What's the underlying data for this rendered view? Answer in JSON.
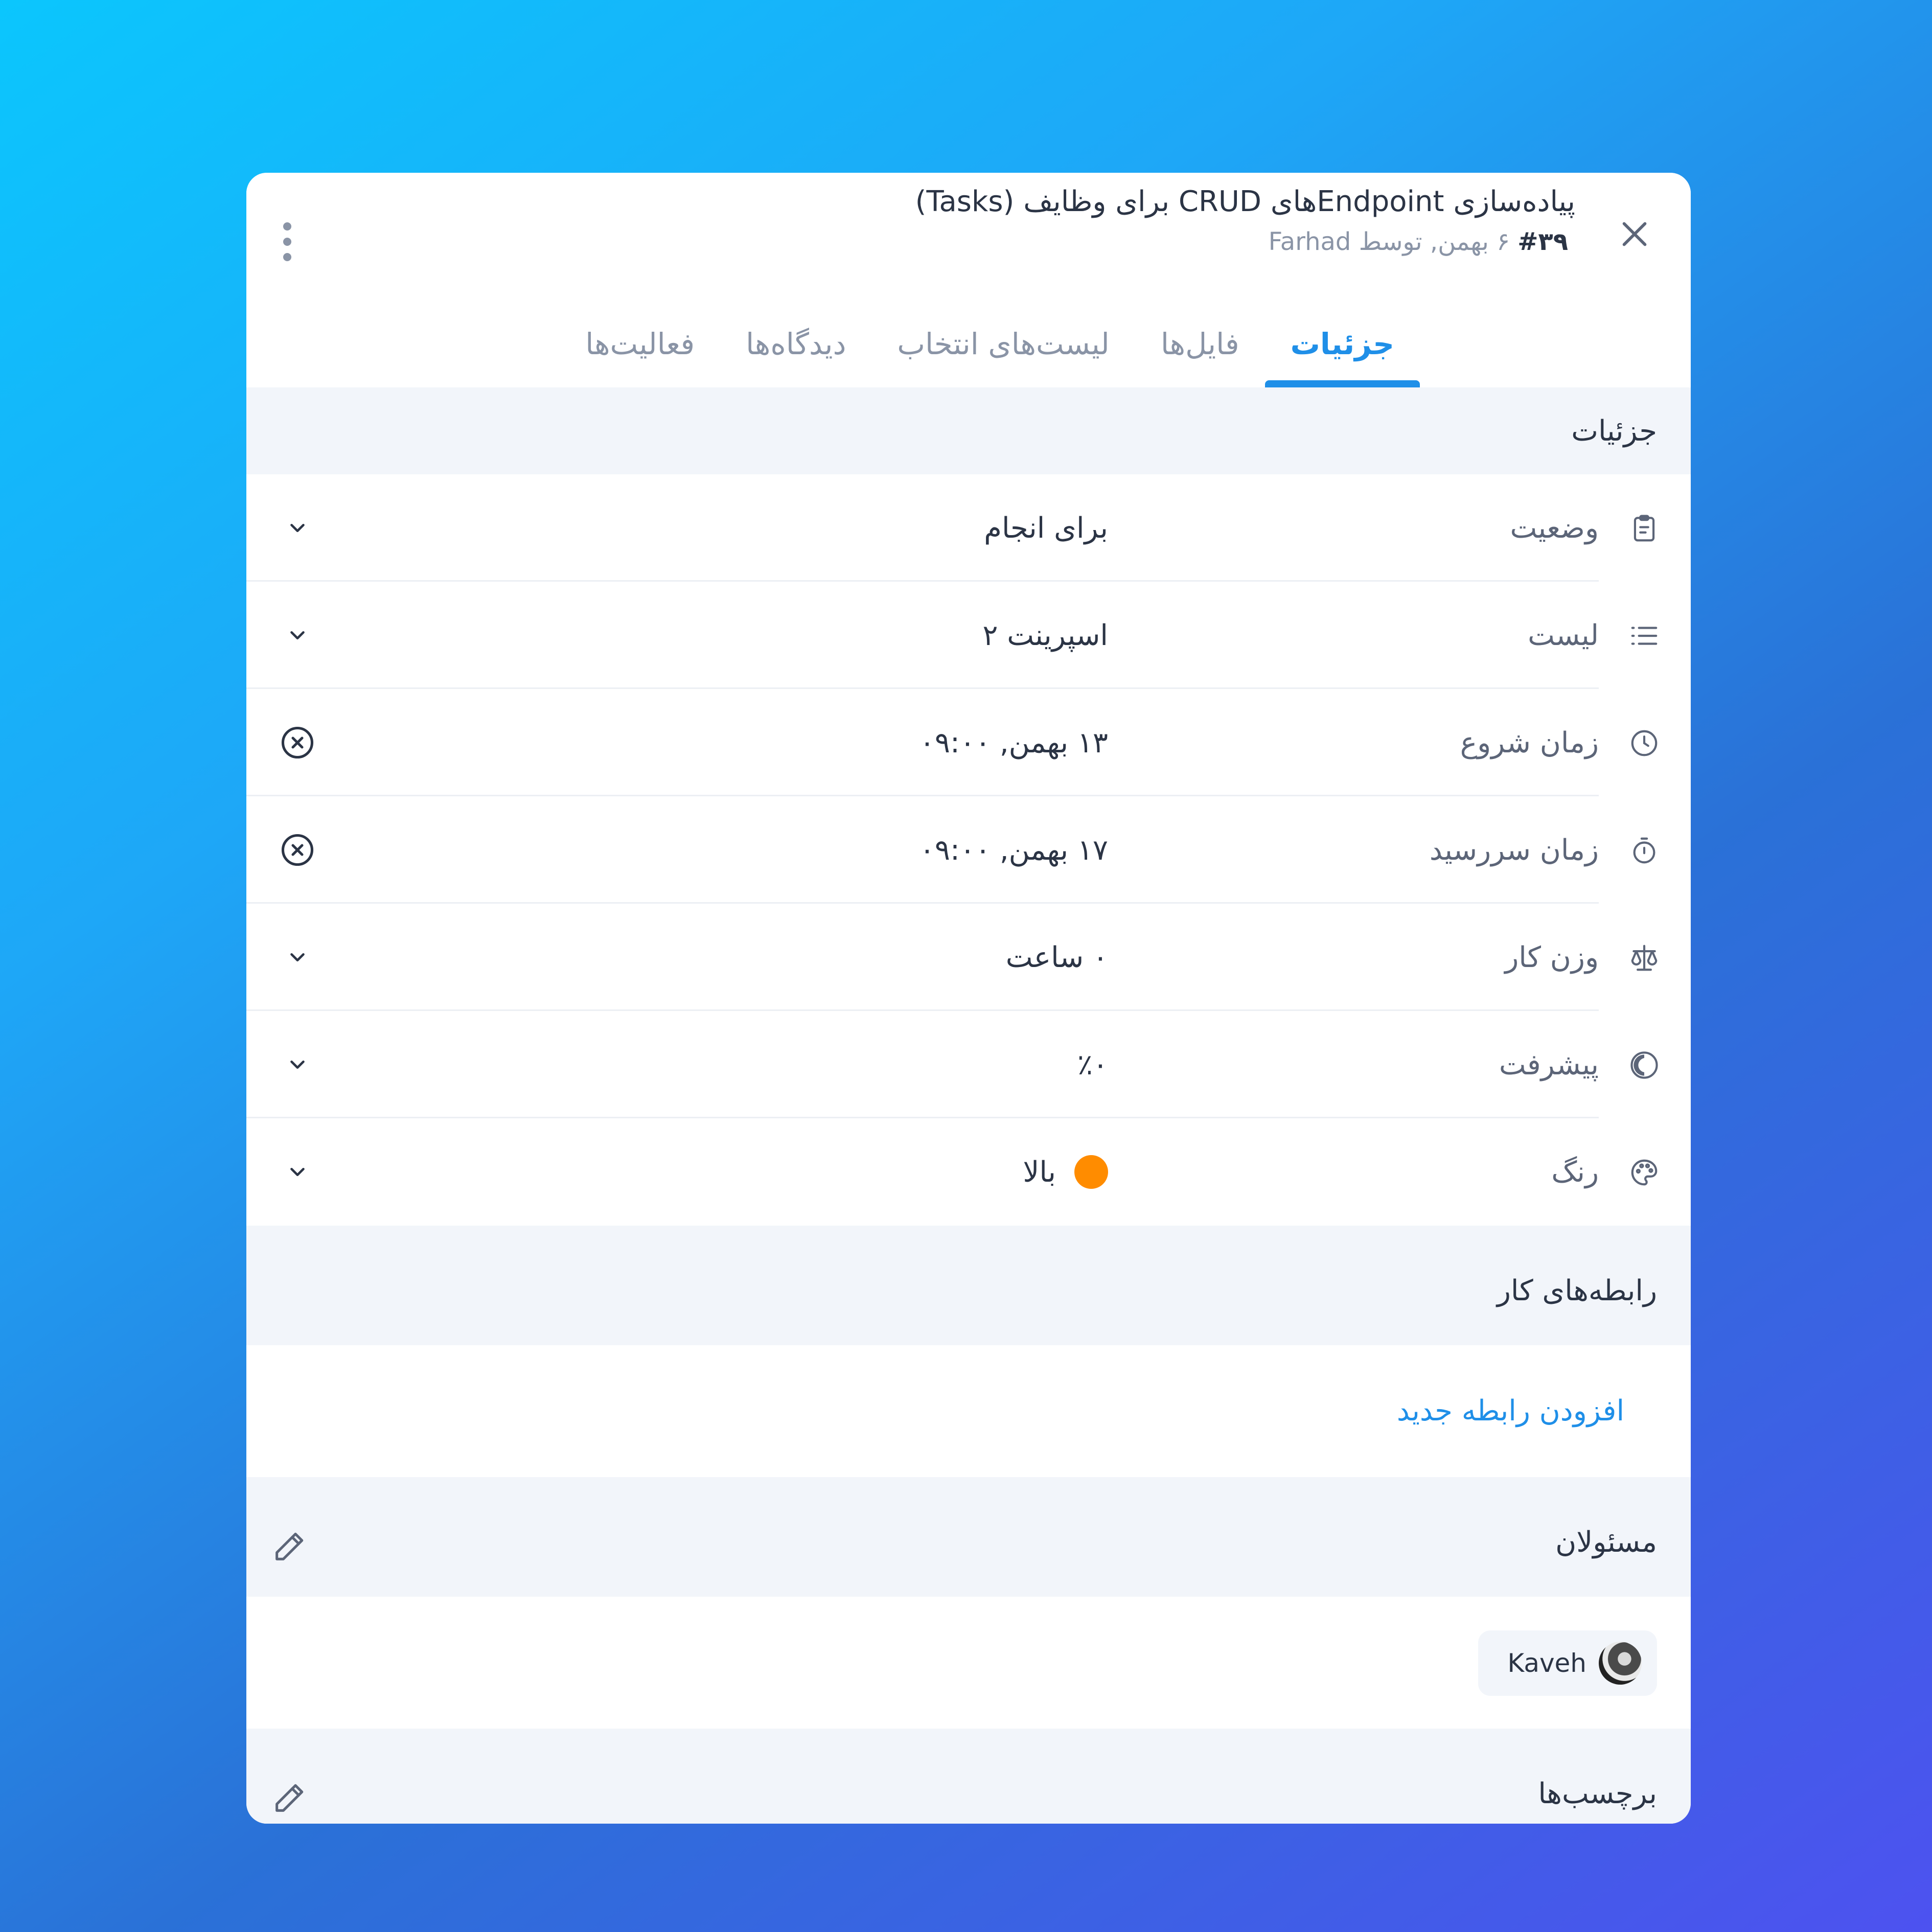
{
  "dialog": {
    "title": "پیاده‌سازی Endpointهای CRUD برای وظایف (Tasks)",
    "task_number": "#۳۹",
    "meta": "۶ بهمن, توسط Farhad"
  },
  "tabs": [
    {
      "label": "جزئیات",
      "active": true
    },
    {
      "label": "فایل‌ها",
      "active": false
    },
    {
      "label": "لیست‌های انتخاب",
      "active": false
    },
    {
      "label": "دیدگاه‌ها",
      "active": false
    },
    {
      "label": "فعالیت‌ها",
      "active": false
    }
  ],
  "details": {
    "heading": "جزئیات",
    "fields": [
      {
        "label": "وضعیت",
        "value": "برای انجام",
        "icon": "clipboard-icon",
        "action": "chevron-down-icon"
      },
      {
        "label": "لیست",
        "value": "اسپرینت ۲",
        "icon": "list-icon",
        "action": "chevron-down-icon"
      },
      {
        "label": "زمان شروع",
        "value": "۱۳ بهمن, ۰۹:۰۰",
        "icon": "clock-icon",
        "action": "clear-icon"
      },
      {
        "label": "زمان سررسید",
        "value": "۱۷ بهمن, ۰۹:۰۰",
        "icon": "timer-icon",
        "action": "clear-icon"
      },
      {
        "label": "وزن کار",
        "value": "۰ ساعت",
        "icon": "scale-icon",
        "action": "chevron-down-icon"
      },
      {
        "label": "پیشرفت",
        "value": "٪۰",
        "icon": "progress-icon",
        "action": "chevron-down-icon"
      },
      {
        "label": "رنگ",
        "value": "بالا",
        "icon": "palette-icon",
        "action": "chevron-down-icon",
        "swatch_color": "#ff8c00"
      }
    ]
  },
  "relations": {
    "heading": "رابطه‌های کار",
    "add_label": "افزودن رابطه جدید"
  },
  "assignees": {
    "heading": "مسئولان",
    "people": [
      {
        "name": "Kaveh"
      }
    ]
  },
  "labels": {
    "heading": "برچسب‌ها"
  },
  "colors": {
    "accent": "#1f8fe8",
    "text": "#2b3445",
    "muted": "#8a94a6",
    "section_bg": "#f2f5fa",
    "priority_high": "#ff8c00"
  }
}
